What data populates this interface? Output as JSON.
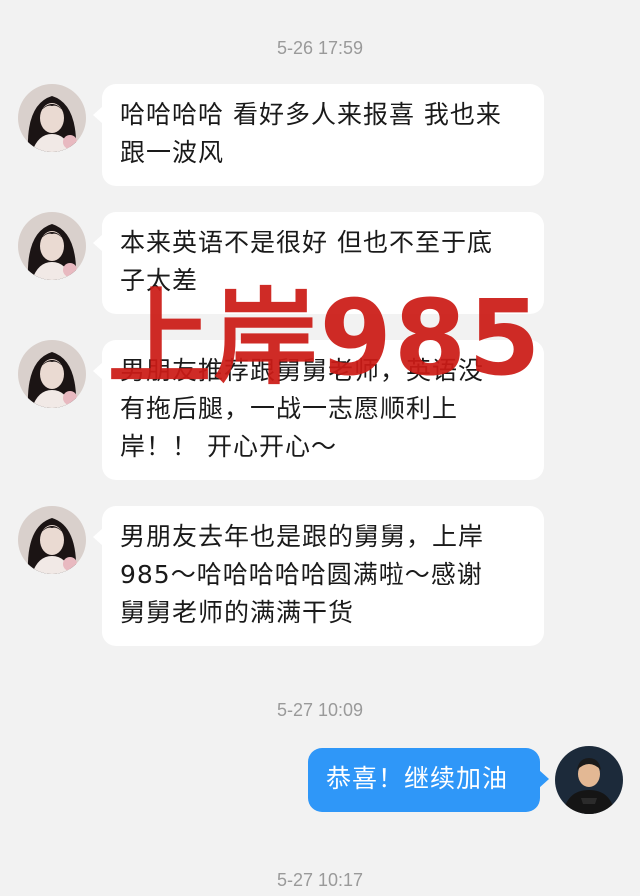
{
  "timestamps": [
    "5-26 17:59",
    "5-27 10:09",
    "5-27 10:17"
  ],
  "messages": [
    {
      "sender": "friend",
      "lines": [
        "哈哈哈哈 看好多人来报喜 我也来",
        "跟一波风"
      ]
    },
    {
      "sender": "friend",
      "lines": [
        "本来英语不是很好 但也不至于底",
        "子太差"
      ]
    },
    {
      "sender": "friend",
      "lines": [
        "男朋友推荐跟舅舅老师，英语没",
        "有拖后腿，一战一志愿顺利上",
        "岸！！ 开心开心～"
      ]
    },
    {
      "sender": "friend",
      "lines": [
        "男朋友去年也是跟的舅舅，上岸",
        "985～哈哈哈哈哈圆满啦～感谢",
        "舅舅老师的满满干货"
      ]
    },
    {
      "sender": "me",
      "lines": [
        "恭喜！继续加油"
      ]
    }
  ],
  "overlay": {
    "text": "上岸985",
    "color": "#cc1b16"
  },
  "colors": {
    "background": "#f2f2f2",
    "my_bubble": "#2f97f8",
    "friend_bubble": "#ffffff"
  },
  "icons": {
    "friend_avatar": "woman-portrait-avatar",
    "my_avatar": "man-portrait-avatar"
  }
}
